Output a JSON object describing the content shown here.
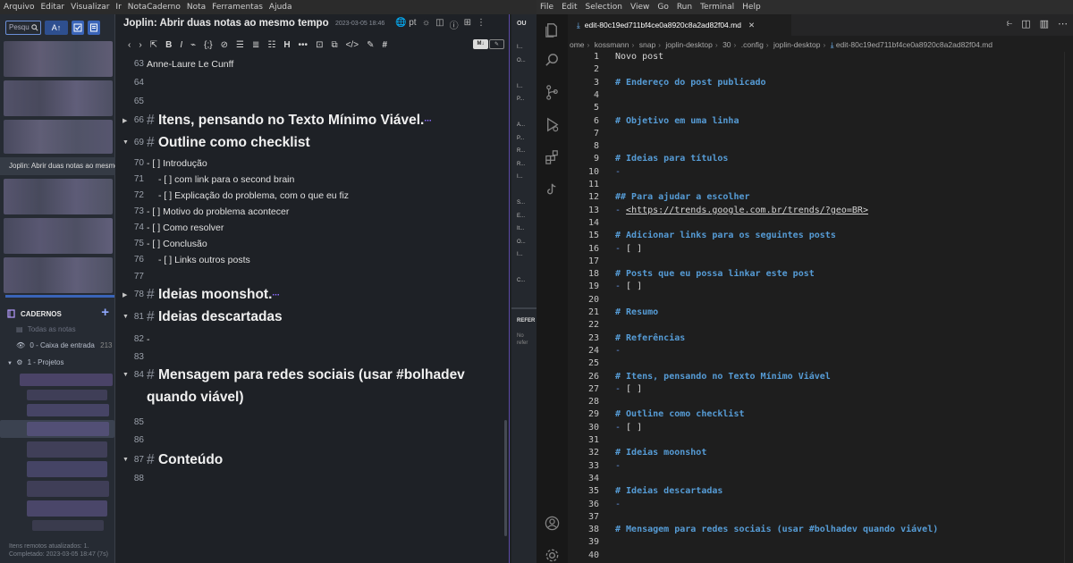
{
  "joplin": {
    "menu": [
      "Arquivo",
      "Editar",
      "Visualizar",
      "Ir",
      "NotaCaderno",
      "Nota",
      "Ferramentas",
      "Ajuda"
    ],
    "sidebar": {
      "search_placeholder": "Pesqu",
      "sort_label": "A",
      "tooltip": "Joplin: Abrir duas notas ao mesmo",
      "notebooks_header": "CADERNOS",
      "all_notes": "Todas as notas",
      "inbox": "0 - Caixa de entrada",
      "inbox_count": "213",
      "projects": "1 - Projetos",
      "sync_line1": "Itens remotos atualizados: 1.",
      "sync_line2": "Completado: 2023-03-05 18:47 (7s)"
    },
    "note": {
      "title": "Joplin: Abrir duas notas ao mesmo tempo",
      "date": "2023-03-05 18:46",
      "lang": "pt",
      "editor_mode": "M↓",
      "lines": [
        {
          "n": "63",
          "text": "Anne-Laure Le Cunff"
        },
        {
          "n": "64",
          "text": ""
        },
        {
          "n": "65",
          "text": ""
        },
        {
          "n": "66",
          "heading": "Itens, pensando no Texto Mínimo Viável.",
          "folded": true
        },
        {
          "n": "69",
          "heading": "Outline como checklist",
          "open": true
        },
        {
          "n": "70",
          "bullet": "-",
          "box": "[ ]",
          "text": "Introdução"
        },
        {
          "n": "71",
          "bullet": "-",
          "box": "[ ]",
          "text": "com link para o second brain",
          "indent": true
        },
        {
          "n": "72",
          "bullet": "-",
          "box": "[ ]",
          "text": "Explicação do problema, com o que eu fiz",
          "indent": true
        },
        {
          "n": "73",
          "bullet": "-",
          "box": "[ ]",
          "text": "Motivo do problema acontecer"
        },
        {
          "n": "74",
          "bullet": "-",
          "box": "[ ]",
          "text": "Como resolver"
        },
        {
          "n": "75",
          "bullet": "-",
          "box": "[ ]",
          "text": "Conclusão"
        },
        {
          "n": "76",
          "bullet": "-",
          "box": "[ ]",
          "text": "Links outros posts",
          "indent": true
        },
        {
          "n": "77",
          "text": ""
        },
        {
          "n": "78",
          "heading": "Ideias moonshot.",
          "folded": true
        },
        {
          "n": "81",
          "heading": "Ideias descartadas",
          "open": true
        },
        {
          "n": "82",
          "bullet": "-",
          "text": ""
        },
        {
          "n": "83",
          "text": ""
        },
        {
          "n": "84",
          "heading": "Mensagem para redes sociais (usar #bolhadev",
          "heading2": "quando viável)",
          "open": true
        },
        {
          "n": "85",
          "text": ""
        },
        {
          "n": "86",
          "text": ""
        },
        {
          "n": "87",
          "heading": "Conteúdo",
          "open": true
        },
        {
          "n": "88",
          "text": ""
        }
      ]
    },
    "outline": {
      "title": "OU",
      "items": [
        "I...",
        "O...",
        "",
        "I...",
        "P...",
        "",
        "A...",
        "P...",
        "R...",
        "R...",
        "I...",
        "",
        "S...",
        "E...",
        "It...",
        "O...",
        "I...",
        "",
        "C..."
      ],
      "ref_title": "REFER",
      "ref_text_1": "No",
      "ref_text_2": "refer"
    }
  },
  "vscode": {
    "menu": [
      "File",
      "Edit",
      "Selection",
      "View",
      "Go",
      "Run",
      "Terminal",
      "Help"
    ],
    "tab": {
      "label": "edit-80c19ed711bf4ce0a8920c8a2ad82f04.md"
    },
    "breadcrumb": [
      "ome",
      "kossmann",
      "snap",
      "joplin-desktop",
      "30",
      ".config",
      "joplin-desktop",
      "edit-80c19ed711bf4ce0a8920c8a2ad82f04.md"
    ],
    "lines": [
      {
        "n": "1",
        "t": "Novo post",
        "k": "plain"
      },
      {
        "n": "2",
        "t": "",
        "k": "plain"
      },
      {
        "n": "3",
        "t": "# Endereço do post publicado",
        "k": "head"
      },
      {
        "n": "4",
        "t": "",
        "k": "plain"
      },
      {
        "n": "5",
        "t": "",
        "k": "plain"
      },
      {
        "n": "6",
        "t": "# Objetivo em uma linha",
        "k": "head"
      },
      {
        "n": "7",
        "t": "",
        "k": "plain"
      },
      {
        "n": "8",
        "t": "",
        "k": "plain"
      },
      {
        "n": "9",
        "t": "# Ideias para títulos",
        "k": "head"
      },
      {
        "n": "10",
        "t": "-",
        "k": "dash"
      },
      {
        "n": "11",
        "t": "",
        "k": "plain"
      },
      {
        "n": "12",
        "t": "## Para ajudar a escolher",
        "k": "head"
      },
      {
        "n": "13",
        "t": "- <https://trends.google.com.br/trends/?geo=BR>",
        "k": "link"
      },
      {
        "n": "14",
        "t": "",
        "k": "plain"
      },
      {
        "n": "15",
        "t": "# Adicionar links para os seguintes posts",
        "k": "head"
      },
      {
        "n": "16",
        "t": "- [ ]",
        "k": "dash"
      },
      {
        "n": "17",
        "t": "",
        "k": "plain"
      },
      {
        "n": "18",
        "t": "# Posts que eu possa linkar este post",
        "k": "head"
      },
      {
        "n": "19",
        "t": "- [ ]",
        "k": "dash"
      },
      {
        "n": "20",
        "t": "",
        "k": "plain"
      },
      {
        "n": "21",
        "t": "# Resumo",
        "k": "head"
      },
      {
        "n": "22",
        "t": "",
        "k": "plain"
      },
      {
        "n": "23",
        "t": "# Referências",
        "k": "head"
      },
      {
        "n": "24",
        "t": "-",
        "k": "dash"
      },
      {
        "n": "25",
        "t": "",
        "k": "plain"
      },
      {
        "n": "26",
        "t": "# Itens, pensando no Texto Mínimo Viável",
        "k": "head"
      },
      {
        "n": "27",
        "t": "- [ ]",
        "k": "dash"
      },
      {
        "n": "28",
        "t": "",
        "k": "plain"
      },
      {
        "n": "29",
        "t": "# Outline como checklist",
        "k": "head"
      },
      {
        "n": "30",
        "t": "- [ ]",
        "k": "dash"
      },
      {
        "n": "31",
        "t": "",
        "k": "plain"
      },
      {
        "n": "32",
        "t": "# Ideias moonshot",
        "k": "head"
      },
      {
        "n": "33",
        "t": "-",
        "k": "dash"
      },
      {
        "n": "34",
        "t": "",
        "k": "plain"
      },
      {
        "n": "35",
        "t": "# Ideias descartadas",
        "k": "head"
      },
      {
        "n": "36",
        "t": "-",
        "k": "dash"
      },
      {
        "n": "37",
        "t": "",
        "k": "plain"
      },
      {
        "n": "38",
        "t": "# Mensagem para redes sociais (usar #bolhadev quando viável)",
        "k": "head"
      },
      {
        "n": "39",
        "t": "",
        "k": "plain"
      },
      {
        "n": "40",
        "t": "",
        "k": "plain"
      }
    ]
  },
  "colors": {
    "joplin_accent": "#3a64b8",
    "vscode_heading": "#569cd6",
    "vscode_link_blue": "#75beff"
  }
}
